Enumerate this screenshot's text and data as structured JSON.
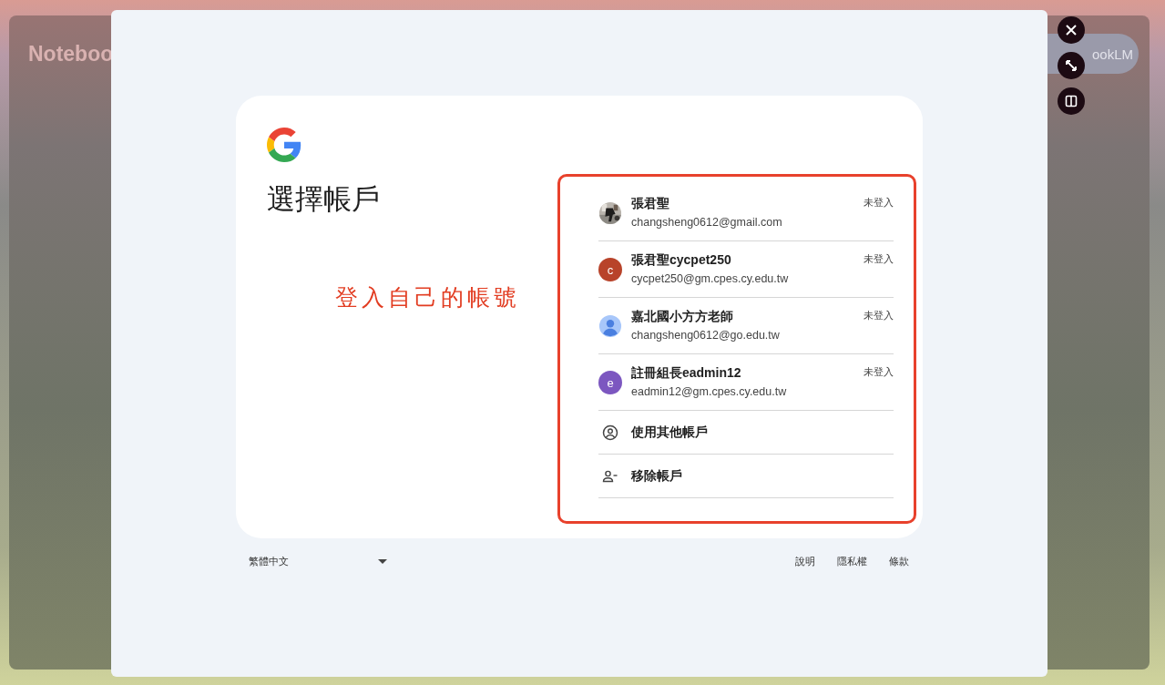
{
  "backdrop": {
    "app_title": "Noteboo",
    "app_button": "ookLM"
  },
  "overlay_controls": [
    {
      "kind": "close"
    },
    {
      "kind": "expand"
    },
    {
      "kind": "split"
    }
  ],
  "dialog": {
    "title": "選擇帳戶",
    "annotation": "登入自己的帳號",
    "accounts": [
      {
        "name": "張君聖",
        "email": "changsheng0612@gmail.com",
        "status": "未登入"
      },
      {
        "kind": "letter",
        "letter": "c",
        "color": "#b8432a",
        "name": "張君聖cycpet250",
        "email": "cycpet250@gm.cpes.cy.edu.tw",
        "status": "未登入"
      },
      {
        "kind": "default",
        "name": "嘉北國小方方老師",
        "email": "changsheng0612@go.edu.tw",
        "status": "未登入"
      },
      {
        "kind": "letter",
        "letter": "e",
        "color": "#7c57c0",
        "name": "註冊組長eadmin12",
        "email": "eadmin12@gm.cpes.cy.edu.tw",
        "status": "未登入"
      }
    ],
    "actions": [
      {
        "kind": "add",
        "label": "使用其他帳戶"
      },
      {
        "kind": "remove",
        "label": "移除帳戶"
      }
    ]
  },
  "footer": {
    "language": "繁體中文",
    "links": [
      "說明",
      "隱私權",
      "條款"
    ]
  }
}
